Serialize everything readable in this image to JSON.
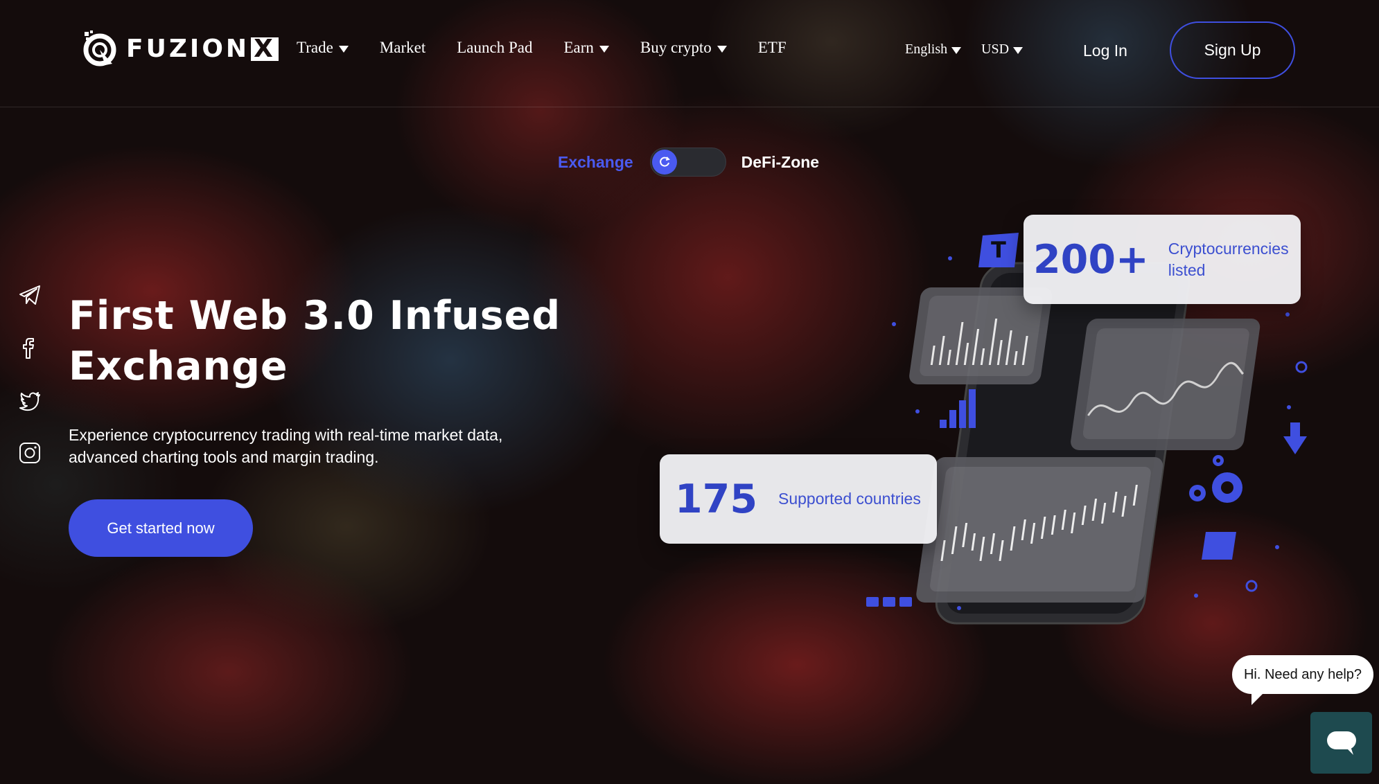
{
  "brand": {
    "name": "FUZION",
    "mark": "X"
  },
  "nav": {
    "items": [
      {
        "label": "Trade",
        "dropdown": true
      },
      {
        "label": "Market",
        "dropdown": false
      },
      {
        "label": "Launch Pad",
        "dropdown": false
      },
      {
        "label": "Earn",
        "dropdown": true
      },
      {
        "label": "Buy crypto",
        "dropdown": true
      },
      {
        "label": "ETF",
        "dropdown": false
      }
    ]
  },
  "header": {
    "language": "English",
    "currency": "USD",
    "login_label": "Log In",
    "signup_label": "Sign Up"
  },
  "toggle": {
    "left_label": "Exchange",
    "right_label": "DeFi-Zone",
    "active": "Exchange"
  },
  "social": [
    "telegram-icon",
    "facebook-icon",
    "twitter-icon",
    "instagram-icon"
  ],
  "hero": {
    "title_line1": "First Web 3.0 Infused",
    "title_line2": "Exchange",
    "description_line1": "Experience cryptocurrency trading with real-time market data,",
    "description_line2": "advanced charting tools and margin trading.",
    "cta_label": "Get started now"
  },
  "stats": {
    "cryptos": {
      "value": "200+",
      "label_line1": "Cryptocurrencies",
      "label_line2": "listed"
    },
    "countries": {
      "value": "175",
      "label": "Supported countries"
    }
  },
  "help": {
    "bubble_text": "Hi. Need any help?"
  },
  "colors": {
    "accent": "#3f4fe0",
    "chat": "#1e4a4f"
  }
}
